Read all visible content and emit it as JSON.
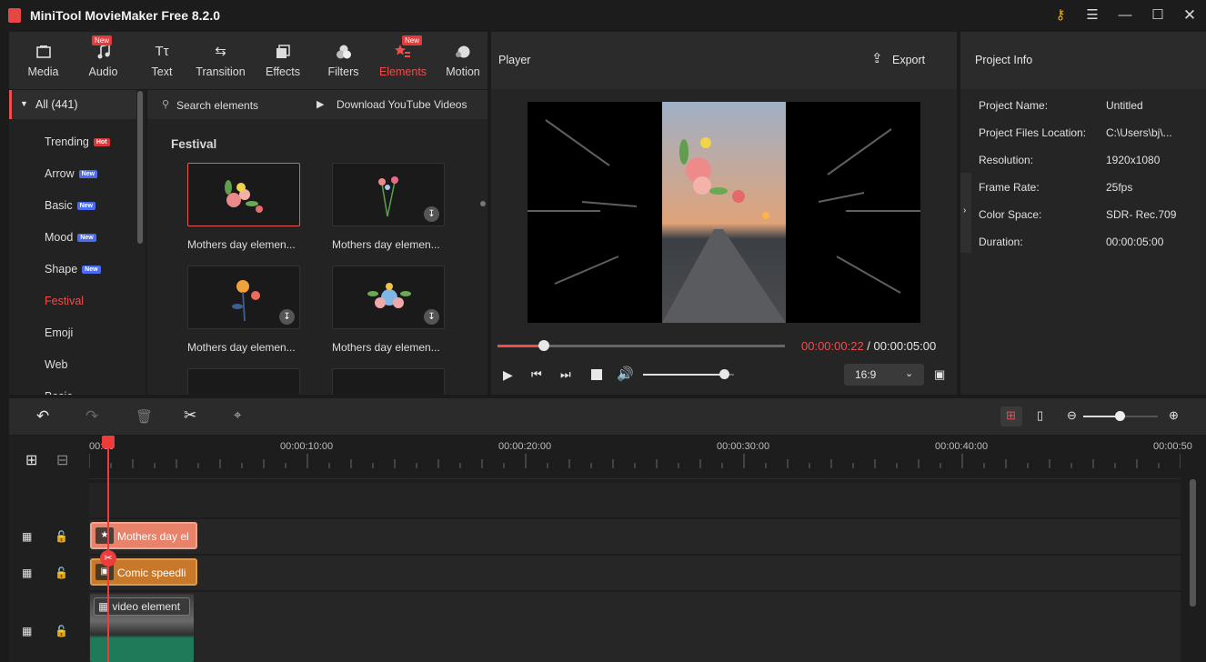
{
  "window": {
    "title": "MiniTool MovieMaker Free 8.2.0",
    "controls": [
      "key-icon",
      "menu-icon",
      "minimize-icon",
      "maximize-icon",
      "close-icon"
    ]
  },
  "toolbar": {
    "items": [
      {
        "label": "Media",
        "icon": "media-icon",
        "badge": ""
      },
      {
        "label": "Audio",
        "icon": "audio-icon",
        "badge": "New"
      },
      {
        "label": "Text",
        "icon": "text-icon",
        "badge": ""
      },
      {
        "label": "Transition",
        "icon": "transition-icon",
        "badge": ""
      },
      {
        "label": "Effects",
        "icon": "effects-icon",
        "badge": ""
      },
      {
        "label": "Filters",
        "icon": "filters-icon",
        "badge": ""
      },
      {
        "label": "Elements",
        "icon": "elements-icon",
        "badge": "New"
      },
      {
        "label": "Motion",
        "icon": "motion-icon",
        "badge": ""
      }
    ],
    "active": "Elements"
  },
  "sidebar": {
    "all_label": "All (441)",
    "items": [
      {
        "label": "Trending",
        "tag": "Hot"
      },
      {
        "label": "Arrow",
        "tag": "New"
      },
      {
        "label": "Basic",
        "tag": "New"
      },
      {
        "label": "Mood",
        "tag": "New"
      },
      {
        "label": "Shape",
        "tag": "New"
      },
      {
        "label": "Festival",
        "tag": ""
      },
      {
        "label": "Emoji",
        "tag": ""
      },
      {
        "label": "Web",
        "tag": ""
      },
      {
        "label": "Basic",
        "tag": ""
      }
    ],
    "active": "Festival"
  },
  "content": {
    "search_placeholder": "Search elements",
    "download_label": "Download YouTube Videos",
    "section_title": "Festival",
    "items": [
      {
        "label": "Mothers day elemen...",
        "selected": true,
        "download": false
      },
      {
        "label": "Mothers day elemen...",
        "selected": false,
        "download": true
      },
      {
        "label": "Mothers day elemen...",
        "selected": false,
        "download": true
      },
      {
        "label": "Mothers day elemen...",
        "selected": false,
        "download": true
      }
    ]
  },
  "player": {
    "title": "Player",
    "export_label": "Export",
    "current_time": "00:00:00:22",
    "separator": " / ",
    "total_time": "00:00:05:00",
    "aspect_ratio": "16:9",
    "progress": 0.16,
    "volume": 0.9
  },
  "project_info": {
    "title": "Project Info",
    "fields": [
      {
        "key": "Project Name:",
        "value": "Untitled"
      },
      {
        "key": "Project Files Location:",
        "value": "C:\\Users\\bj\\..."
      },
      {
        "key": "Resolution:",
        "value": "1920x1080"
      },
      {
        "key": "Frame Rate:",
        "value": "25fps"
      },
      {
        "key": "Color Space:",
        "value": "SDR- Rec.709"
      },
      {
        "key": "Duration:",
        "value": "00:00:05:00"
      }
    ]
  },
  "timeline": {
    "ticks": [
      "00:00",
      "00:00:10:00",
      "00:00:20:00",
      "00:00:30:00",
      "00:00:40:00",
      "00:00:50"
    ],
    "clips": [
      {
        "label": "Mothers day el",
        "color": "#e8826a"
      },
      {
        "label": "Comic speedli",
        "color": "#c8782a"
      },
      {
        "label": "video element",
        "color": "#3a3a3a"
      }
    ],
    "zoom": 0.5
  },
  "colors": {
    "accent": "#ee4d4d",
    "panel": "#252525",
    "background": "#1b1b1b"
  }
}
